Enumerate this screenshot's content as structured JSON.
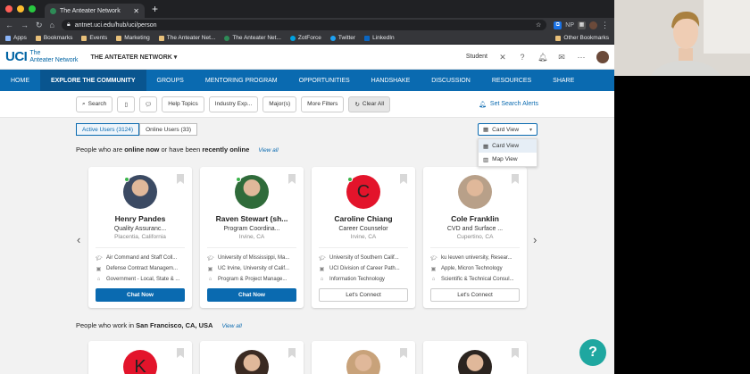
{
  "browser": {
    "tab_title": "The Anteater Network",
    "url": "antnet.uci.edu/hub/uci/person",
    "bookmarks": [
      "Apps",
      "Bookmarks",
      "Events",
      "Marketing",
      "The Anteater Net...",
      "The Anteater Net...",
      "ZotForce",
      "Twitter",
      "LinkedIn"
    ],
    "other_bookmarks": "Other Bookmarks",
    "ext_np": "NP"
  },
  "header": {
    "logo_text": "UCI",
    "logo_sub_line1": "The",
    "logo_sub_line2": "Anteater Network",
    "network_title": "THE ANTEATER NETWORK ▾",
    "role": "Student"
  },
  "nav": [
    "HOME",
    "EXPLORE THE COMMUNITY",
    "GROUPS",
    "MENTORING PROGRAM",
    "OPPORTUNITIES",
    "HANDSHAKE",
    "DISCUSSION",
    "RESOURCES",
    "SHARE"
  ],
  "filters": {
    "search": "Search",
    "help_topics": "Help Topics",
    "industry": "Industry Exp...",
    "majors": "Major(s)",
    "more": "More Filters",
    "clear": "Clear All",
    "alerts": "Set Search Alerts"
  },
  "user_tabs": {
    "active": "Active Users (3124)",
    "online": "Online Users (33)"
  },
  "view": {
    "selected": "Card View",
    "options": [
      "Card View",
      "Map View"
    ]
  },
  "section1": {
    "prefix": "People who are",
    "bold1": "online now",
    "mid": "or have been",
    "bold2": "recently online",
    "view_all": "View all"
  },
  "section2": {
    "prefix": "People who work in",
    "bold": "San Francisco, CA, USA",
    "view_all": "View all"
  },
  "cards": [
    {
      "name": "Henry Pandes",
      "title": "Quality Assuranc...",
      "location": "Placentia, California",
      "edu": "Air Command and Staff Coll...",
      "work": "Defense Contract Managem...",
      "industry": "Government - Local, State & ...",
      "button": "Chat Now",
      "online": true,
      "avatar_type": "photo",
      "avatar_color": "#3b4a63"
    },
    {
      "name": "Raven Stewart (sh...",
      "title": "Program Coordina...",
      "location": "Irvine, CA",
      "edu": "University of Mississippi, Ma...",
      "work": "UC Irvine, University of Calif...",
      "industry": "Program & Project Manage...",
      "button": "Chat Now",
      "online": true,
      "avatar_type": "photo",
      "avatar_color": "#2f6b3a"
    },
    {
      "name": "Caroline Chiang",
      "title": "Career Counselor",
      "location": "Irvine, CA",
      "edu": "University of Southern Calif...",
      "work": "UCI Division of Career Path...",
      "industry": "Information Technology",
      "button": "Let's Connect",
      "online": true,
      "avatar_type": "letter",
      "avatar_letter": "C"
    },
    {
      "name": "Cole Franklin",
      "title": "CVD and Surface ...",
      "location": "Cupertino, CA",
      "edu": "ku leuven university, Resear...",
      "work": "Apple, Micron Technology",
      "industry": "Scientific & Technical Consul...",
      "button": "Let's Connect",
      "online": false,
      "avatar_type": "photo",
      "avatar_color": "#b8a089"
    }
  ],
  "cards2": [
    {
      "avatar_type": "letter",
      "avatar_letter": "K"
    },
    {
      "avatar_type": "photo",
      "avatar_color": "#3a2a22"
    },
    {
      "avatar_type": "photo",
      "avatar_color": "#c8a27a"
    },
    {
      "avatar_type": "photo",
      "avatar_color": "#2b2420"
    }
  ],
  "help_label": "?",
  "colors": {
    "accent": "#0a6ab0",
    "chat_button": "#0a6ab0",
    "help": "#1fa7a0",
    "online": "#3cb44b"
  }
}
